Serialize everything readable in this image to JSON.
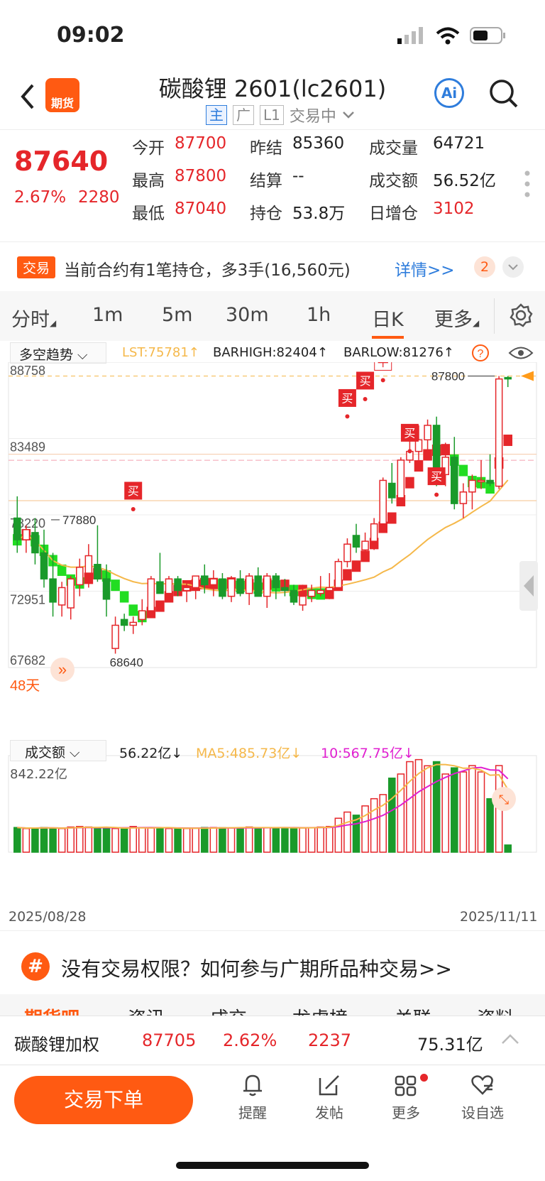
{
  "status_bar": {
    "time": "09:02"
  },
  "header": {
    "title": "碳酸锂 2601(lc2601)",
    "logo_text": "期货",
    "ai_label": "Ai",
    "sub_tags": [
      "主",
      "广",
      "L1"
    ],
    "trading_status": "交易中"
  },
  "quote": {
    "last_price": "87640",
    "change_pct": "2.67%",
    "change_abs": "2280",
    "fields": [
      {
        "label": "今开",
        "value": "87700",
        "color": "red"
      },
      {
        "label": "昨结",
        "value": "85360",
        "color": "black"
      },
      {
        "label": "成交量",
        "value": "64721",
        "color": "black"
      },
      {
        "label": "最高",
        "value": "87800",
        "color": "red"
      },
      {
        "label": "结算",
        "value": "--",
        "color": "black"
      },
      {
        "label": "成交额",
        "value": "56.52亿",
        "color": "black"
      },
      {
        "label": "最低",
        "value": "87040",
        "color": "red"
      },
      {
        "label": "持仓",
        "value": "53.8万",
        "color": "black"
      },
      {
        "label": "日增仓",
        "value": "3102",
        "color": "red"
      }
    ]
  },
  "position_banner": {
    "tag": "交易",
    "text": "当前合约有1笔持仓，多3手(16,560元)",
    "link": "详情>>",
    "count": "2"
  },
  "tabs": [
    "分时",
    "1m",
    "5m",
    "30m",
    "1h",
    "日K",
    "更多"
  ],
  "active_tab": "日K",
  "indicator": {
    "name": "多空趋势",
    "lst": "LST:75781↑",
    "barhigh": "BARHIGH:82404↑",
    "barlow": "BARLOW:81276↑"
  },
  "price_axis": {
    "labels": [
      "88758",
      "83489",
      "78220",
      "72951",
      "67682"
    ]
  },
  "annotations": {
    "high": "87800",
    "low": "68640",
    "mid": "77880",
    "days": "48天",
    "signals": [
      "买",
      "买",
      "买",
      "平",
      "买",
      "买"
    ]
  },
  "volume": {
    "name": "成交额",
    "value": "56.22亿↓",
    "ma5": "MA5:485.73亿↓",
    "ma10": "10:567.75亿↓",
    "max_label": "842.22亿",
    "date_start": "2025/08/28",
    "date_end": "2025/11/11"
  },
  "cta": {
    "text": "没有交易权限？如何参与广期所品种交易>>"
  },
  "detail_tabs": [
    "期货吧",
    "资讯",
    "成交",
    "龙虎榜",
    "关联",
    "资料"
  ],
  "weighted": {
    "name": "碳酸锂加权",
    "price": "87705",
    "pct": "2.62%",
    "change": "2237",
    "amount": "75.31亿"
  },
  "bottom_bar": {
    "trade_button": "交易下单",
    "items": [
      "提醒",
      "发帖",
      "更多",
      "设自选"
    ]
  },
  "colors": {
    "up": "#e5262a",
    "down": "#1a9a2a",
    "accent": "#ff5a12",
    "ma": "#f5b84a",
    "ma10": "#e020d0"
  },
  "chart_data": {
    "type": "candlestick",
    "ylim": [
      67682,
      88758
    ],
    "candles": [
      [
        78000,
        79500,
        75600,
        76500
      ],
      [
        76500,
        77500,
        75600,
        77200
      ],
      [
        77000,
        78000,
        74800,
        75600
      ],
      [
        75600,
        77200,
        73200,
        73800
      ],
      [
        73800,
        75600,
        71200,
        72200
      ],
      [
        72000,
        73600,
        71200,
        73200
      ],
      [
        71800,
        74000,
        71000,
        73800
      ],
      [
        73400,
        75200,
        72600,
        74600
      ],
      [
        74200,
        76200,
        73200,
        75400
      ],
      [
        74800,
        77500,
        73600,
        73800
      ],
      [
        73800,
        74800,
        71200,
        72400
      ],
      [
        69000,
        71200,
        68640,
        70600
      ],
      [
        71000,
        71400,
        70200,
        70600
      ],
      [
        70600,
        71200,
        70000,
        70800
      ],
      [
        71000,
        72400,
        70600,
        71600
      ],
      [
        71600,
        74000,
        71200,
        73800
      ],
      [
        73600,
        75600,
        72800,
        72800
      ],
      [
        72800,
        74000,
        72400,
        73800
      ],
      [
        73800,
        74000,
        72600,
        73000
      ],
      [
        73000,
        73600,
        72200,
        73200
      ],
      [
        73200,
        74000,
        72400,
        74000
      ],
      [
        74000,
        74800,
        72800,
        73400
      ],
      [
        73400,
        74400,
        72600,
        73800
      ],
      [
        73800,
        74200,
        72400,
        72600
      ],
      [
        72600,
        74000,
        72200,
        73800
      ],
      [
        73800,
        74400,
        72600,
        72800
      ],
      [
        72800,
        74200,
        72000,
        74000
      ],
      [
        74000,
        74600,
        72800,
        72600
      ],
      [
        72600,
        74200,
        71800,
        74000
      ],
      [
        74000,
        74200,
        72400,
        73200
      ],
      [
        73200,
        73800,
        72600,
        73000
      ],
      [
        73000,
        73400,
        72000,
        72200
      ],
      [
        72000,
        73400,
        71600,
        72600
      ],
      [
        72600,
        73400,
        72200,
        73000
      ],
      [
        72800,
        74000,
        72600,
        73000
      ],
      [
        73000,
        74200,
        72400,
        73200
      ],
      [
        73200,
        75200,
        73000,
        75000
      ],
      [
        75000,
        76600,
        74600,
        76200
      ],
      [
        76800,
        77600,
        75600,
        76000
      ],
      [
        75800,
        77000,
        75200,
        76400
      ],
      [
        76400,
        78000,
        75800,
        77600
      ],
      [
        77600,
        80800,
        77200,
        80600
      ],
      [
        80400,
        81800,
        79000,
        79400
      ],
      [
        79400,
        82200,
        79000,
        82000
      ],
      [
        82000,
        83400,
        81800,
        82600
      ],
      [
        82600,
        84400,
        82000,
        83400
      ],
      [
        83400,
        84800,
        82600,
        84400
      ],
      [
        84400,
        85000,
        80200,
        81000
      ],
      [
        81000,
        83200,
        80200,
        82200
      ],
      [
        82200,
        83600,
        78600,
        79000
      ],
      [
        79000,
        80400,
        78000,
        79800
      ],
      [
        79800,
        81000,
        78600,
        80600
      ],
      [
        80600,
        82000,
        80000,
        80600
      ],
      [
        80600,
        82400,
        80200,
        80400
      ],
      [
        80200,
        87800,
        80000,
        87600
      ],
      [
        87700,
        87800,
        87040,
        87640
      ]
    ],
    "volume": [
      240,
      230,
      235,
      240,
      235,
      230,
      245,
      250,
      245,
      235,
      240,
      230,
      225,
      250,
      240,
      235,
      240,
      230,
      228,
      230,
      235,
      240,
      240,
      238,
      235,
      240,
      245,
      235,
      240,
      235,
      238,
      240,
      235,
      240,
      245,
      250,
      330,
      390,
      360,
      450,
      520,
      560,
      720,
      760,
      880,
      900,
      840,
      880,
      760,
      820,
      780,
      842,
      780,
      520,
      842,
      70
    ]
  }
}
